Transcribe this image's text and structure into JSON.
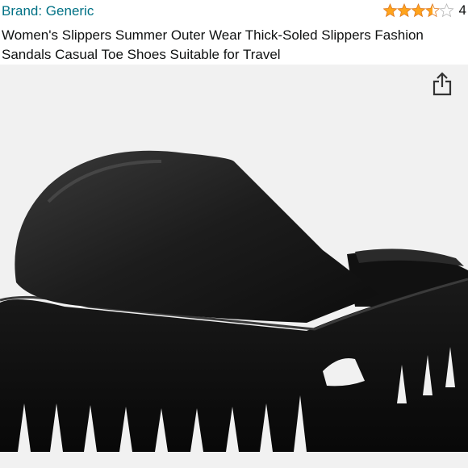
{
  "header": {
    "brand_label": "Brand: Generic",
    "rating_value": 3.5,
    "rating_max": 5,
    "rating_count": "4",
    "star_color": "#ffa41c",
    "title": "Women's Slippers Summer Outer Wear Thick-Soled Slippers Fashion Sandals Casual Toe Shoes Suitable for Travel"
  },
  "gallery": {
    "share_icon": "share-icon",
    "image_alt": "black thick-soled slipper"
  },
  "colors": {
    "brand_link": "#007185",
    "text": "#0f1111",
    "image_background": "#f1f1f1"
  }
}
